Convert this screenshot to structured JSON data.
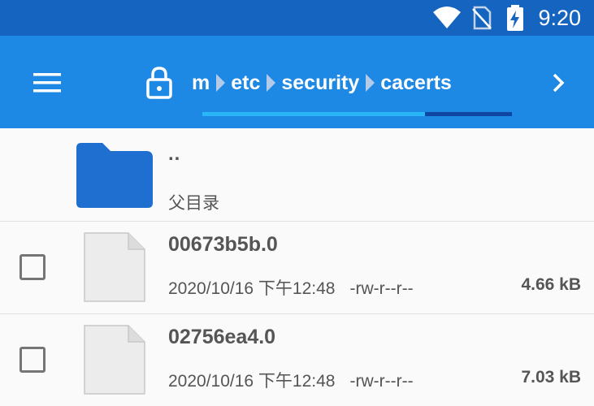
{
  "status_bar": {
    "time": "9:20",
    "icons": [
      "wifi-icon",
      "no-sim-icon",
      "battery-charging-icon"
    ],
    "background": "#1565c0"
  },
  "toolbar": {
    "background": "#1e88e5",
    "menu_icon": "hamburger-menu-icon",
    "lock_icon": "lock-icon",
    "breadcrumbs": [
      "m",
      "etc",
      "security",
      "cacerts"
    ],
    "next_icon": "chevron-right-icon",
    "load_progress": 0.72
  },
  "parent_dir": {
    "name": "..",
    "label": "父目录",
    "icon": "folder-icon",
    "icon_color": "#1e6fd0"
  },
  "files": [
    {
      "name": "00673b5b.0",
      "date": "2020/10/16 下午12:48",
      "permissions": "-rw-r--r--",
      "size": "4.66 kB"
    },
    {
      "name": "02756ea4.0",
      "date": "2020/10/16 下午12:48",
      "permissions": "-rw-r--r--",
      "size": "7.03 kB"
    }
  ]
}
